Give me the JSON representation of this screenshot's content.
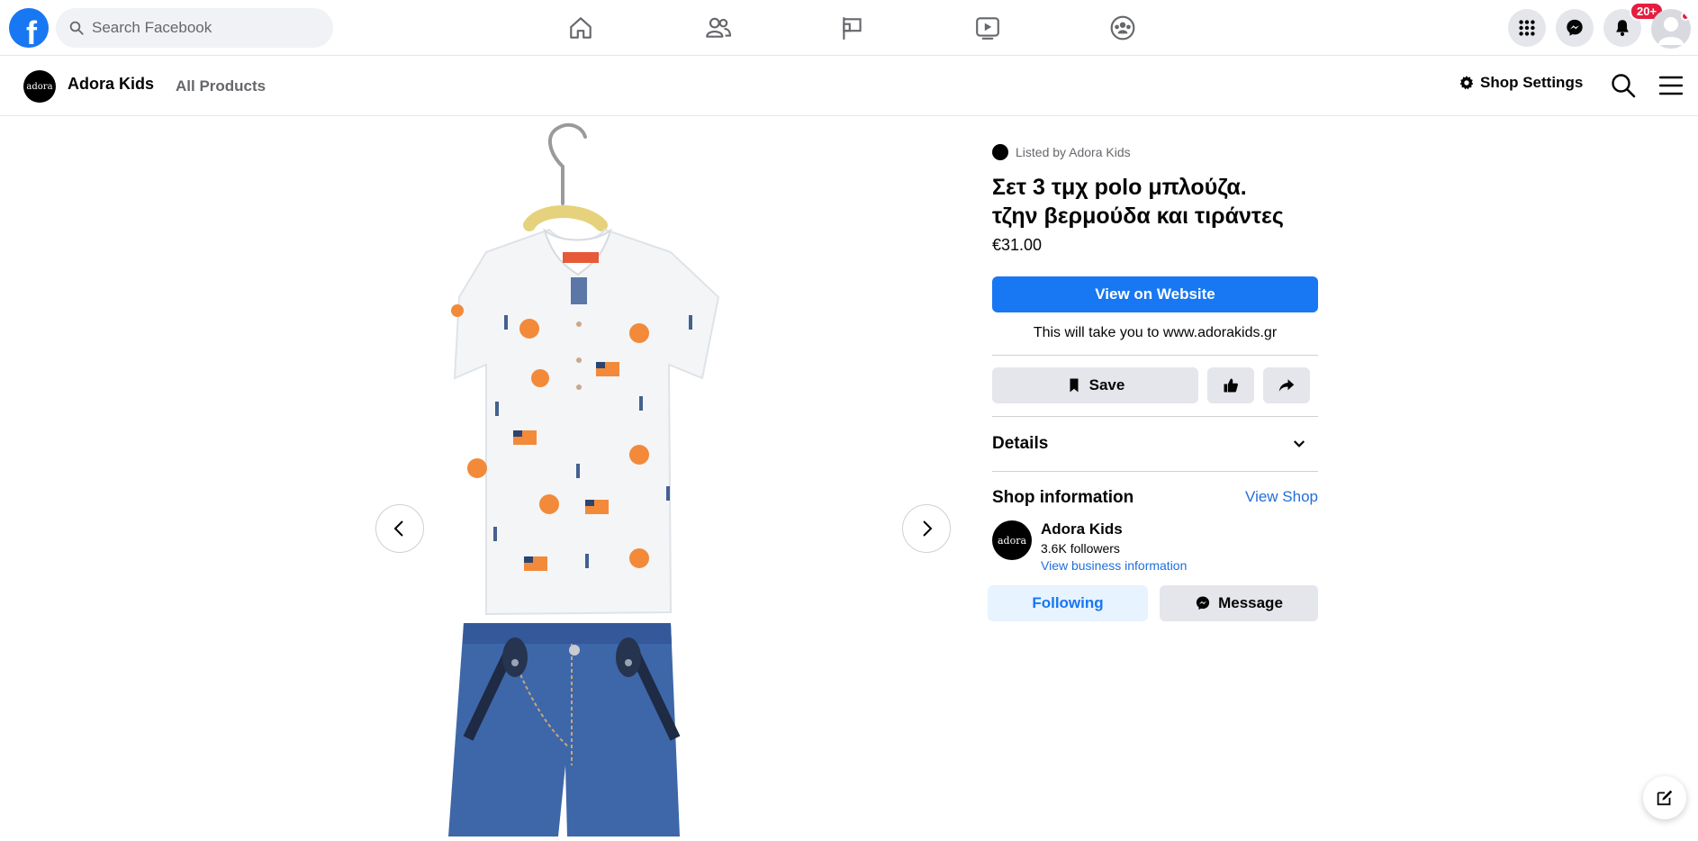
{
  "topbar": {
    "logo_letter": "f",
    "search_placeholder": "Search Facebook",
    "notification_badge": "20+"
  },
  "shopbar": {
    "logo_text": "adora",
    "shop_name": "Adora Kids",
    "all_products": "All Products",
    "shop_settings": "Shop Settings"
  },
  "product": {
    "listed_by": "Listed by Adora Kids",
    "title_line1": "Σετ 3 τμχ polo μπλούζα.",
    "title_line2": "τζην βερμούδα και τιράντες",
    "price": "€31.00",
    "view_on_website": "View on Website",
    "take_you": "This will take you to www.adorakids.gr",
    "save": "Save",
    "details": "Details"
  },
  "shop_info": {
    "heading": "Shop information",
    "view_shop": "View Shop",
    "logo_text": "adora",
    "name": "Adora Kids",
    "followers": "3.6K followers",
    "view_business": "View business information",
    "following": "Following",
    "message": "Message"
  },
  "colors": {
    "brand_blue": "#1877f2",
    "link_blue": "#216fdb",
    "badge_red": "#e41e3f",
    "shirt_orange": "#f28a3a",
    "shirt_navy": "#44618f",
    "denim": "#3d67a8"
  }
}
